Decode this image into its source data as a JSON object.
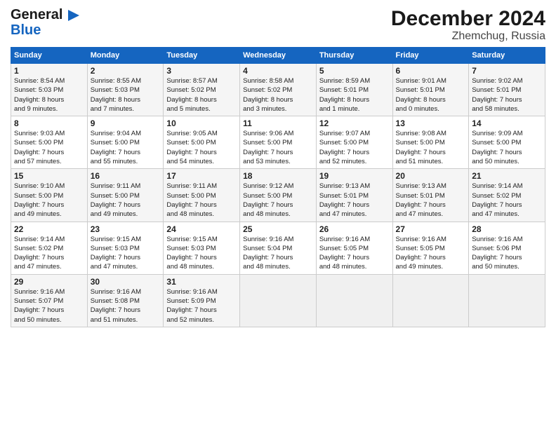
{
  "logo": {
    "line1": "General",
    "line2": "Blue"
  },
  "title": "December 2024",
  "subtitle": "Zhemchug, Russia",
  "days_header": [
    "Sunday",
    "Monday",
    "Tuesday",
    "Wednesday",
    "Thursday",
    "Friday",
    "Saturday"
  ],
  "weeks": [
    [
      {
        "day": "1",
        "info": "Sunrise: 8:54 AM\nSunset: 5:03 PM\nDaylight: 8 hours\nand 9 minutes."
      },
      {
        "day": "2",
        "info": "Sunrise: 8:55 AM\nSunset: 5:03 PM\nDaylight: 8 hours\nand 7 minutes."
      },
      {
        "day": "3",
        "info": "Sunrise: 8:57 AM\nSunset: 5:02 PM\nDaylight: 8 hours\nand 5 minutes."
      },
      {
        "day": "4",
        "info": "Sunrise: 8:58 AM\nSunset: 5:02 PM\nDaylight: 8 hours\nand 3 minutes."
      },
      {
        "day": "5",
        "info": "Sunrise: 8:59 AM\nSunset: 5:01 PM\nDaylight: 8 hours\nand 1 minute."
      },
      {
        "day": "6",
        "info": "Sunrise: 9:01 AM\nSunset: 5:01 PM\nDaylight: 8 hours\nand 0 minutes."
      },
      {
        "day": "7",
        "info": "Sunrise: 9:02 AM\nSunset: 5:01 PM\nDaylight: 7 hours\nand 58 minutes."
      }
    ],
    [
      {
        "day": "8",
        "info": "Sunrise: 9:03 AM\nSunset: 5:00 PM\nDaylight: 7 hours\nand 57 minutes."
      },
      {
        "day": "9",
        "info": "Sunrise: 9:04 AM\nSunset: 5:00 PM\nDaylight: 7 hours\nand 55 minutes."
      },
      {
        "day": "10",
        "info": "Sunrise: 9:05 AM\nSunset: 5:00 PM\nDaylight: 7 hours\nand 54 minutes."
      },
      {
        "day": "11",
        "info": "Sunrise: 9:06 AM\nSunset: 5:00 PM\nDaylight: 7 hours\nand 53 minutes."
      },
      {
        "day": "12",
        "info": "Sunrise: 9:07 AM\nSunset: 5:00 PM\nDaylight: 7 hours\nand 52 minutes."
      },
      {
        "day": "13",
        "info": "Sunrise: 9:08 AM\nSunset: 5:00 PM\nDaylight: 7 hours\nand 51 minutes."
      },
      {
        "day": "14",
        "info": "Sunrise: 9:09 AM\nSunset: 5:00 PM\nDaylight: 7 hours\nand 50 minutes."
      }
    ],
    [
      {
        "day": "15",
        "info": "Sunrise: 9:10 AM\nSunset: 5:00 PM\nDaylight: 7 hours\nand 49 minutes."
      },
      {
        "day": "16",
        "info": "Sunrise: 9:11 AM\nSunset: 5:00 PM\nDaylight: 7 hours\nand 49 minutes."
      },
      {
        "day": "17",
        "info": "Sunrise: 9:11 AM\nSunset: 5:00 PM\nDaylight: 7 hours\nand 48 minutes."
      },
      {
        "day": "18",
        "info": "Sunrise: 9:12 AM\nSunset: 5:00 PM\nDaylight: 7 hours\nand 48 minutes."
      },
      {
        "day": "19",
        "info": "Sunrise: 9:13 AM\nSunset: 5:01 PM\nDaylight: 7 hours\nand 47 minutes."
      },
      {
        "day": "20",
        "info": "Sunrise: 9:13 AM\nSunset: 5:01 PM\nDaylight: 7 hours\nand 47 minutes."
      },
      {
        "day": "21",
        "info": "Sunrise: 9:14 AM\nSunset: 5:02 PM\nDaylight: 7 hours\nand 47 minutes."
      }
    ],
    [
      {
        "day": "22",
        "info": "Sunrise: 9:14 AM\nSunset: 5:02 PM\nDaylight: 7 hours\nand 47 minutes."
      },
      {
        "day": "23",
        "info": "Sunrise: 9:15 AM\nSunset: 5:03 PM\nDaylight: 7 hours\nand 47 minutes."
      },
      {
        "day": "24",
        "info": "Sunrise: 9:15 AM\nSunset: 5:03 PM\nDaylight: 7 hours\nand 48 minutes."
      },
      {
        "day": "25",
        "info": "Sunrise: 9:16 AM\nSunset: 5:04 PM\nDaylight: 7 hours\nand 48 minutes."
      },
      {
        "day": "26",
        "info": "Sunrise: 9:16 AM\nSunset: 5:05 PM\nDaylight: 7 hours\nand 48 minutes."
      },
      {
        "day": "27",
        "info": "Sunrise: 9:16 AM\nSunset: 5:05 PM\nDaylight: 7 hours\nand 49 minutes."
      },
      {
        "day": "28",
        "info": "Sunrise: 9:16 AM\nSunset: 5:06 PM\nDaylight: 7 hours\nand 50 minutes."
      }
    ],
    [
      {
        "day": "29",
        "info": "Sunrise: 9:16 AM\nSunset: 5:07 PM\nDaylight: 7 hours\nand 50 minutes."
      },
      {
        "day": "30",
        "info": "Sunrise: 9:16 AM\nSunset: 5:08 PM\nDaylight: 7 hours\nand 51 minutes."
      },
      {
        "day": "31",
        "info": "Sunrise: 9:16 AM\nSunset: 5:09 PM\nDaylight: 7 hours\nand 52 minutes."
      },
      null,
      null,
      null,
      null
    ]
  ]
}
